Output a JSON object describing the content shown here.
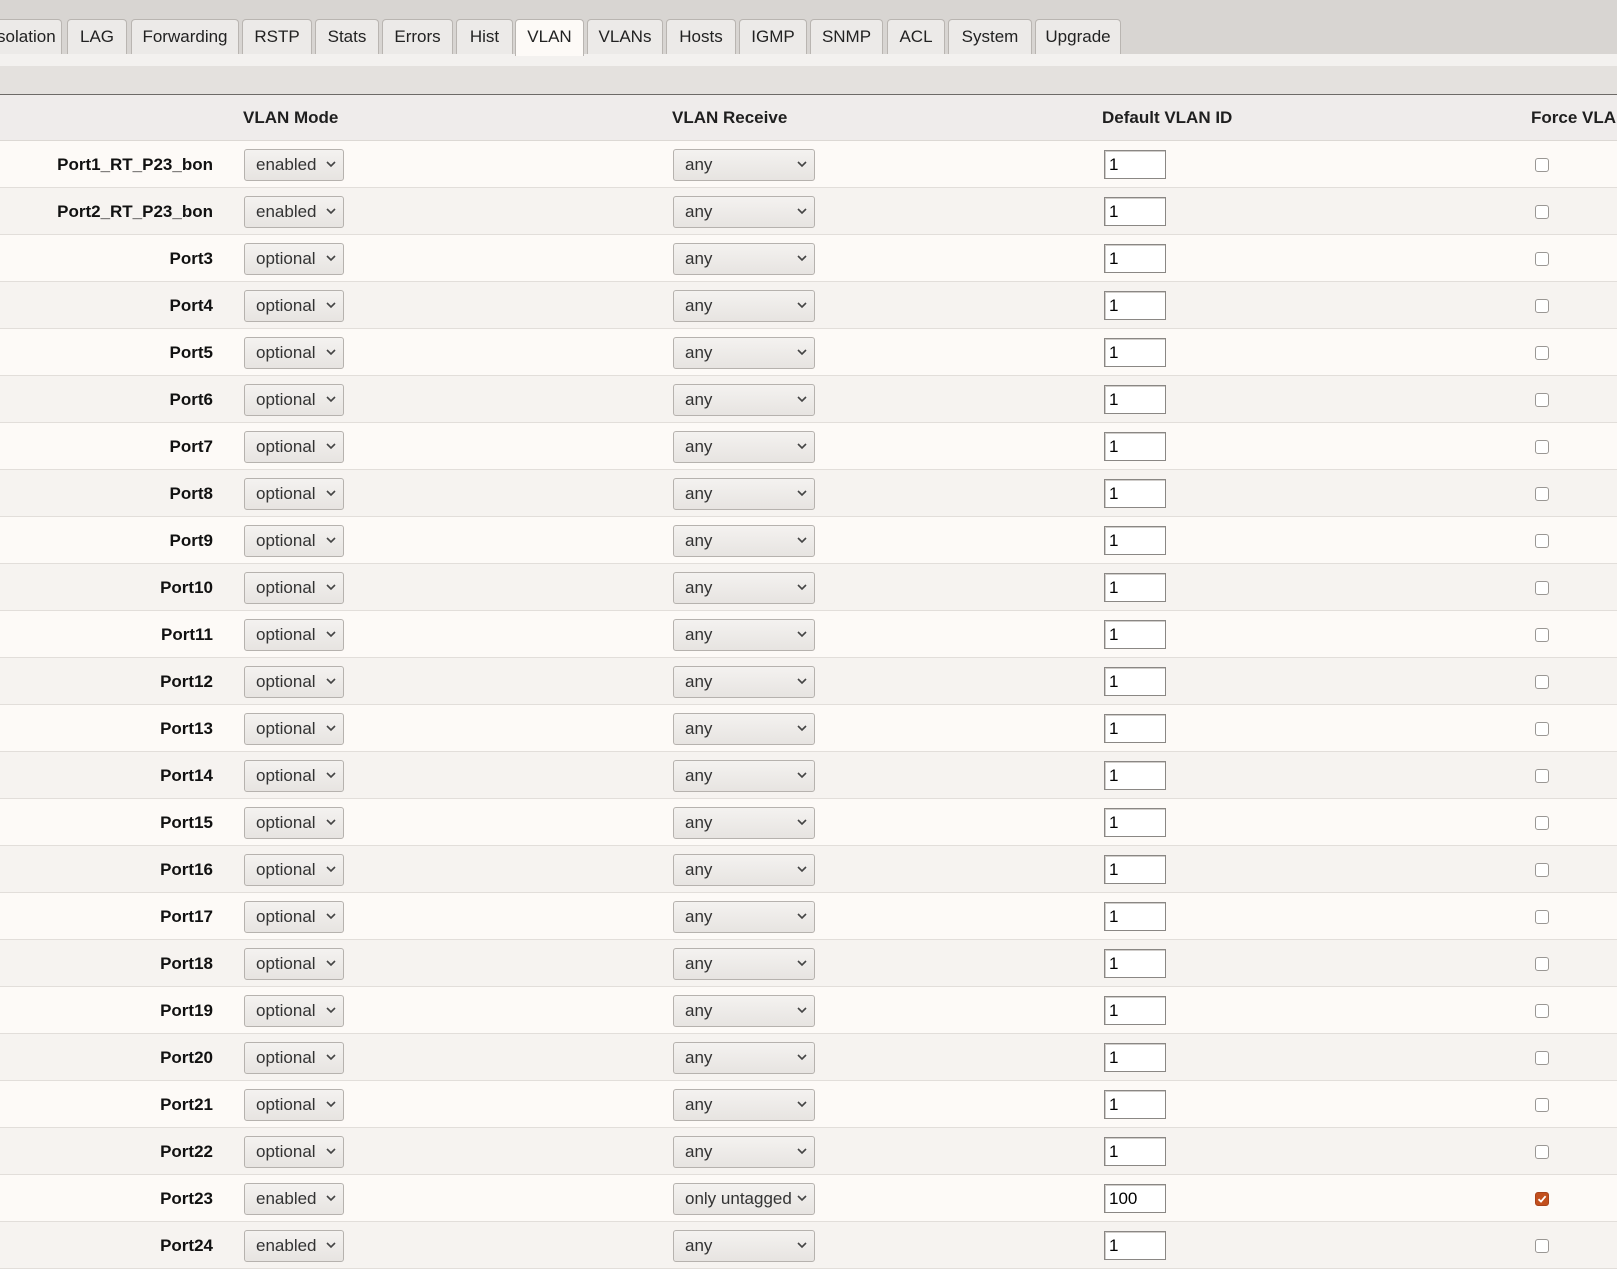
{
  "tabs": [
    {
      "label": "Isolation"
    },
    {
      "label": "LAG"
    },
    {
      "label": "Forwarding"
    },
    {
      "label": "RSTP"
    },
    {
      "label": "Stats"
    },
    {
      "label": "Errors"
    },
    {
      "label": "Hist"
    },
    {
      "label": "VLAN",
      "active": true
    },
    {
      "label": "VLANs"
    },
    {
      "label": "Hosts"
    },
    {
      "label": "IGMP"
    },
    {
      "label": "SNMP"
    },
    {
      "label": "ACL"
    },
    {
      "label": "System"
    },
    {
      "label": "Upgrade"
    }
  ],
  "table": {
    "headers": {
      "vlan_mode": "VLAN Mode",
      "vlan_receive": "VLAN Receive",
      "default_vlan_id": "Default VLAN ID",
      "force_vlan_id": "Force VLAN ID"
    },
    "rows": [
      {
        "port": "Port1_RT_P23_bon",
        "mode": "enabled",
        "receive": "any",
        "vlan_id": "1",
        "force": false
      },
      {
        "port": "Port2_RT_P23_bon",
        "mode": "enabled",
        "receive": "any",
        "vlan_id": "1",
        "force": false
      },
      {
        "port": "Port3",
        "mode": "optional",
        "receive": "any",
        "vlan_id": "1",
        "force": false
      },
      {
        "port": "Port4",
        "mode": "optional",
        "receive": "any",
        "vlan_id": "1",
        "force": false
      },
      {
        "port": "Port5",
        "mode": "optional",
        "receive": "any",
        "vlan_id": "1",
        "force": false
      },
      {
        "port": "Port6",
        "mode": "optional",
        "receive": "any",
        "vlan_id": "1",
        "force": false
      },
      {
        "port": "Port7",
        "mode": "optional",
        "receive": "any",
        "vlan_id": "1",
        "force": false
      },
      {
        "port": "Port8",
        "mode": "optional",
        "receive": "any",
        "vlan_id": "1",
        "force": false
      },
      {
        "port": "Port9",
        "mode": "optional",
        "receive": "any",
        "vlan_id": "1",
        "force": false
      },
      {
        "port": "Port10",
        "mode": "optional",
        "receive": "any",
        "vlan_id": "1",
        "force": false
      },
      {
        "port": "Port11",
        "mode": "optional",
        "receive": "any",
        "vlan_id": "1",
        "force": false
      },
      {
        "port": "Port12",
        "mode": "optional",
        "receive": "any",
        "vlan_id": "1",
        "force": false
      },
      {
        "port": "Port13",
        "mode": "optional",
        "receive": "any",
        "vlan_id": "1",
        "force": false
      },
      {
        "port": "Port14",
        "mode": "optional",
        "receive": "any",
        "vlan_id": "1",
        "force": false
      },
      {
        "port": "Port15",
        "mode": "optional",
        "receive": "any",
        "vlan_id": "1",
        "force": false
      },
      {
        "port": "Port16",
        "mode": "optional",
        "receive": "any",
        "vlan_id": "1",
        "force": false
      },
      {
        "port": "Port17",
        "mode": "optional",
        "receive": "any",
        "vlan_id": "1",
        "force": false
      },
      {
        "port": "Port18",
        "mode": "optional",
        "receive": "any",
        "vlan_id": "1",
        "force": false
      },
      {
        "port": "Port19",
        "mode": "optional",
        "receive": "any",
        "vlan_id": "1",
        "force": false
      },
      {
        "port": "Port20",
        "mode": "optional",
        "receive": "any",
        "vlan_id": "1",
        "force": false
      },
      {
        "port": "Port21",
        "mode": "optional",
        "receive": "any",
        "vlan_id": "1",
        "force": false
      },
      {
        "port": "Port22",
        "mode": "optional",
        "receive": "any",
        "vlan_id": "1",
        "force": false
      },
      {
        "port": "Port23",
        "mode": "enabled",
        "receive": "only untagged",
        "vlan_id": "100",
        "force": true
      },
      {
        "port": "Port24",
        "mode": "enabled",
        "receive": "any",
        "vlan_id": "1",
        "force": false
      }
    ]
  },
  "colors": {
    "accent_checkbox": "#c24f1d",
    "tabbar_bg": "#d8d5d2",
    "page_bg": "#fdfaf7"
  }
}
